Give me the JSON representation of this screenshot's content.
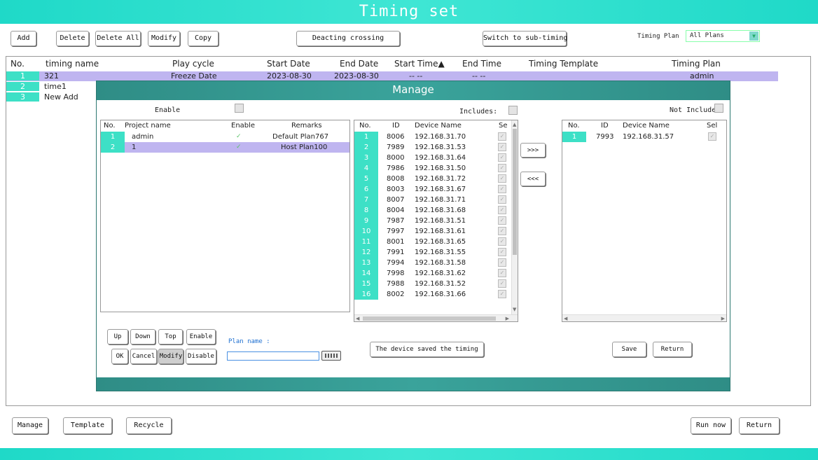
{
  "title": "Timing set",
  "toolbar": {
    "add": "Add",
    "delete": "Delete",
    "delete_all": "Delete All",
    "modify": "Modify",
    "copy": "Copy",
    "deacting": "Deacting crossing",
    "switch": "Switch to sub-timing",
    "plan_label": "Timing Plan",
    "plan_value": "All Plans"
  },
  "grid": {
    "columns": [
      "No.",
      "timing name",
      "Play cycle",
      "Start Date",
      "End Date",
      "Start Time▲",
      "End Time",
      "Timing Template",
      "Timing Plan"
    ],
    "rows": [
      {
        "no": "1",
        "name": "321",
        "cycle": "Freeze Date",
        "start_date": "2023-08-30",
        "end_date": "2023-08-30",
        "start_time": "-- --",
        "end_time": "-- --",
        "template": "",
        "plan": "admin"
      },
      {
        "no": "2",
        "name": "time1"
      },
      {
        "no": "3",
        "name": "New Add"
      }
    ]
  },
  "manage": {
    "title": "Manage",
    "enable_label": "Enable",
    "projects": {
      "columns": [
        "No.",
        "Project name",
        "Enable",
        "Remarks"
      ],
      "rows": [
        {
          "no": "1",
          "name": "admin",
          "enabled": "✓",
          "remarks": "Default Plan767"
        },
        {
          "no": "2",
          "name": "1",
          "enabled": "✓",
          "remarks": "Host Plan100"
        }
      ]
    },
    "includes_label": "Includes:",
    "includes": {
      "columns": [
        "No.",
        "ID",
        "Device Name",
        "Se"
      ],
      "rows": [
        {
          "no": "1",
          "id": "8006",
          "name": "192.168.31.70"
        },
        {
          "no": "2",
          "id": "7989",
          "name": "192.168.31.53"
        },
        {
          "no": "3",
          "id": "8000",
          "name": "192.168.31.64"
        },
        {
          "no": "4",
          "id": "7986",
          "name": "192.168.31.50"
        },
        {
          "no": "5",
          "id": "8008",
          "name": "192.168.31.72"
        },
        {
          "no": "6",
          "id": "8003",
          "name": "192.168.31.67"
        },
        {
          "no": "7",
          "id": "8007",
          "name": "192.168.31.71"
        },
        {
          "no": "8",
          "id": "8004",
          "name": "192.168.31.68"
        },
        {
          "no": "9",
          "id": "7987",
          "name": "192.168.31.51"
        },
        {
          "no": "10",
          "id": "7997",
          "name": "192.168.31.61"
        },
        {
          "no": "11",
          "id": "8001",
          "name": "192.168.31.65"
        },
        {
          "no": "12",
          "id": "7991",
          "name": "192.168.31.55"
        },
        {
          "no": "13",
          "id": "7994",
          "name": "192.168.31.58"
        },
        {
          "no": "14",
          "id": "7998",
          "name": "192.168.31.62"
        },
        {
          "no": "15",
          "id": "7988",
          "name": "192.168.31.52"
        },
        {
          "no": "16",
          "id": "8002",
          "name": "192.168.31.66"
        }
      ]
    },
    "move_right": ">>>",
    "move_left": "<<<",
    "not_include_label": "Not Include:",
    "not_include": {
      "columns": [
        "No.",
        "ID",
        "Device Name",
        "Sel"
      ],
      "rows": [
        {
          "no": "1",
          "id": "7993",
          "name": "192.168.31.57"
        }
      ]
    },
    "buttons": {
      "up": "Up",
      "down": "Down",
      "top": "Top",
      "enable": "Enable",
      "ok": "OK",
      "cancel": "Cancel",
      "modify": "Modify",
      "disable": "Disable",
      "saved_timing": "The device saved the timing",
      "save": "Save",
      "return": "Return"
    },
    "plan_name_label": "Plan name :",
    "plan_name_value": ""
  },
  "footer": {
    "manage": "Manage",
    "template": "Template",
    "recycle": "Recycle",
    "run_now": "Run now",
    "return": "Return"
  },
  "colors": {
    "accent": "#3de0c6",
    "selection": "#bfb5f0",
    "dialog_header": "#2f8d86"
  }
}
